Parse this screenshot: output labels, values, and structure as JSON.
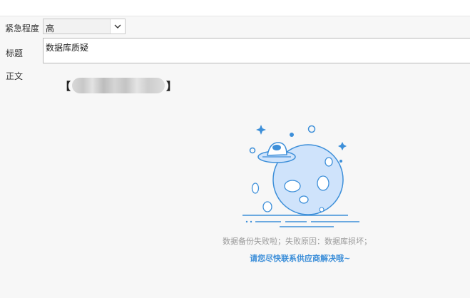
{
  "form": {
    "urgency": {
      "label": "紧急程度",
      "value": "高"
    },
    "title": {
      "label": "标题",
      "value": "数据库质疑"
    },
    "body": {
      "label": "正文"
    }
  },
  "redacted_text": {
    "open": "【",
    "close": "】"
  },
  "error": {
    "message": "数据备份失败啦；失败原因：数据库损坏；",
    "hint": "请您尽快联系供应商解决哦~"
  },
  "colors": {
    "accent": "#3d8fd9",
    "planet_fill": "#cfe3fb",
    "muted_text": "#999999"
  },
  "icons": {
    "select_arrow": "chevron-down-icon",
    "illustration": "planet-ufo-illustration"
  }
}
